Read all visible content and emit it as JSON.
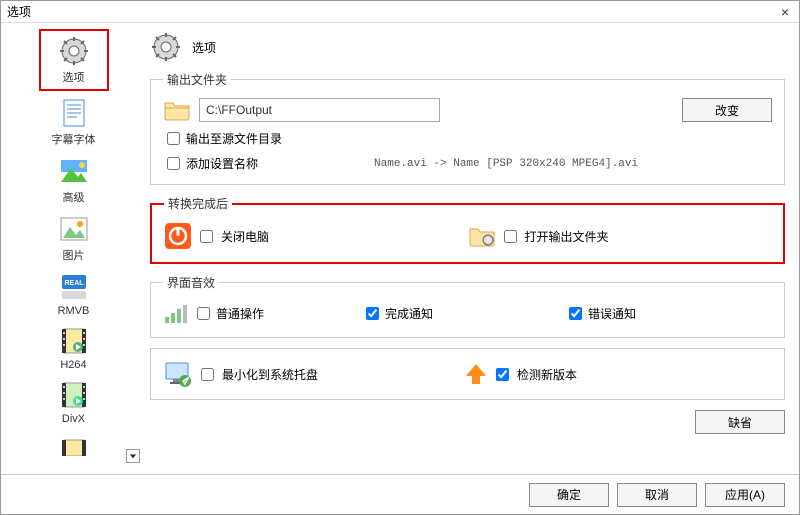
{
  "window": {
    "title": "选项"
  },
  "sidebar": {
    "items": [
      {
        "label": "选项"
      },
      {
        "label": "字幕字体"
      },
      {
        "label": "高级"
      },
      {
        "label": "图片"
      },
      {
        "label": "RMVB"
      },
      {
        "label": "H264"
      },
      {
        "label": "DivX"
      }
    ]
  },
  "header": {
    "title": "选项"
  },
  "output_group": {
    "legend": "输出文件夹",
    "path": "C:\\FFOutput",
    "change_btn": "改变",
    "chk_source_dir": "输出至源文件目录",
    "chk_append_setting": "添加设置名称",
    "example": "Name.avi  -> Name [PSP 320x240 MPEG4].avi"
  },
  "after_group": {
    "legend": "转换完成后",
    "chk_shutdown": "关闭电脑",
    "chk_open_folder": "打开输出文件夹"
  },
  "sound_group": {
    "legend": "界面音效",
    "chk_normal": "普通操作",
    "chk_complete": "完成通知",
    "chk_error": "错误通知"
  },
  "misc_group": {
    "chk_minimize_tray": "最小化到系统托盘",
    "chk_check_update": "检测新版本"
  },
  "defaults_btn": "缺省",
  "footer": {
    "ok": "确定",
    "cancel": "取消",
    "apply": "应用(A)"
  }
}
